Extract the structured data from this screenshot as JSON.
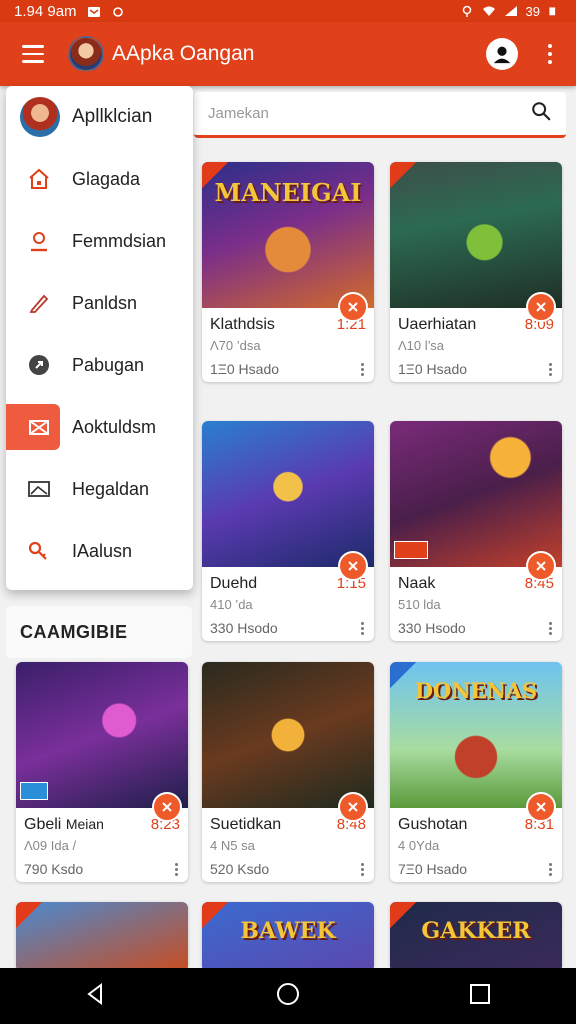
{
  "status_bar": {
    "time": "1.94 9am",
    "battery": "39"
  },
  "app_bar": {
    "title": "AApka Oangan"
  },
  "search": {
    "placeholder": "Jamekan"
  },
  "drawer": {
    "title": "Apllklcian",
    "items": [
      {
        "label": "Glagada",
        "icon": "home-icon"
      },
      {
        "label": "Femmdsian",
        "icon": "person-icon"
      },
      {
        "label": "Panldsn",
        "icon": "pen-icon"
      },
      {
        "label": "Pabugan",
        "icon": "chat-icon"
      },
      {
        "label": "Aoktuldsm",
        "icon": "mail-icon",
        "active": true
      },
      {
        "label": "Hegaldan",
        "icon": "image-icon"
      },
      {
        "label": "IAalusn",
        "icon": "key-icon"
      }
    ]
  },
  "section": {
    "title": "CAAMGIBIE"
  },
  "cards": [
    {
      "art_title": "MANEIGAI",
      "name": "Klathdsis",
      "time": "1:21",
      "sub": "Λ70 ’dsa",
      "count": "1Ξ0 Hsado"
    },
    {
      "art_title": "",
      "name": "Uaerhiatan",
      "time": "8:09",
      "sub": "Λ10 l’sa",
      "count": "1Ξ0 Hsado"
    },
    {
      "art_title": "",
      "name": "Duehd",
      "time": "1:15",
      "sub": "410 ’da",
      "count": "330 Hsodo"
    },
    {
      "art_title": "",
      "name": "Naak",
      "time": "8:45",
      "sub": "510 lda",
      "count": "330 Hsodo"
    },
    {
      "art_title": "",
      "name": "Gbeli",
      "name2": "Meian",
      "time": "8:23",
      "sub": "Λ09 Ida /",
      "count": "790 Ksdo"
    },
    {
      "art_title": "",
      "name": "Suetidkan",
      "time": "8:48",
      "sub": "4 N5 sa",
      "count": "520 Ksdo"
    },
    {
      "art_title": "DONENAS",
      "name": "Gushotan",
      "time": "8:31",
      "sub": "4 0Yda",
      "count": "7Ξ0 Hsado"
    },
    {
      "art_title": "",
      "name": "",
      "time": "",
      "sub": "",
      "count": ""
    },
    {
      "art_title": "BAWEK",
      "name": "",
      "time": "",
      "sub": "",
      "count": ""
    },
    {
      "art_title": "GAKKER",
      "name": "",
      "time": "",
      "sub": "",
      "count": ""
    }
  ],
  "colors": {
    "accent": "#e0401a",
    "accent_light": "#ef5b3e"
  }
}
